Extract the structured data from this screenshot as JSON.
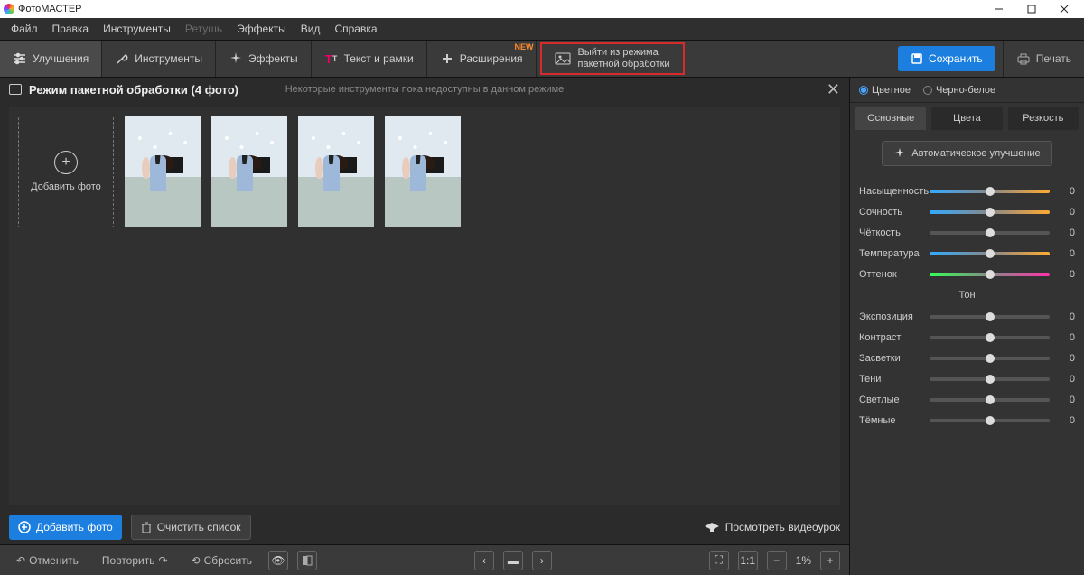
{
  "titlebar": {
    "title": "ФотоМАСТЕР"
  },
  "menu": {
    "items": [
      "Файл",
      "Правка",
      "Инструменты",
      "Ретушь",
      "Эффекты",
      "Вид",
      "Справка"
    ],
    "disabled_index": 3
  },
  "toolbar": {
    "improve": "Улучшения",
    "tools": "Инструменты",
    "effects": "Эффекты",
    "text": "Текст и рамки",
    "ext": "Расширения",
    "ext_new": "NEW",
    "exit_l1": "Выйти из режима",
    "exit_l2": "пакетной обработки",
    "save": "Сохранить",
    "print": "Печать"
  },
  "batch": {
    "title": "Режим пакетной обработки (4 фото)",
    "note": "Некоторые инструменты пока недоступны в данном режиме",
    "add": "Добавить фото",
    "add2": "Добавить фото",
    "clear": "Очистить список",
    "video": "Посмотреть видеоурок"
  },
  "status": {
    "undo": "Отменить",
    "redo": "Повторить",
    "reset": "Сбросить",
    "ratio": "1:1",
    "zoom": "1%"
  },
  "right": {
    "color": "Цветное",
    "bw": "Черно-белое",
    "tab_basic": "Основные",
    "tab_color": "Цвета",
    "tab_sharp": "Резкость",
    "auto": "Автоматическое улучшение",
    "group_tone": "Тон",
    "sliders1": [
      {
        "label": "Насыщенность",
        "kind": "hue",
        "val": "0"
      },
      {
        "label": "Сочность",
        "kind": "hue",
        "val": "0"
      },
      {
        "label": "Чёткость",
        "kind": "",
        "val": "0"
      },
      {
        "label": "Температура",
        "kind": "temp",
        "val": "0"
      },
      {
        "label": "Оттенок",
        "kind": "tint",
        "val": "0"
      }
    ],
    "sliders2": [
      {
        "label": "Экспозиция",
        "val": "0"
      },
      {
        "label": "Контраст",
        "val": "0"
      },
      {
        "label": "Засветки",
        "val": "0"
      },
      {
        "label": "Тени",
        "val": "0"
      },
      {
        "label": "Светлые",
        "val": "0"
      },
      {
        "label": "Тёмные",
        "val": "0"
      }
    ]
  }
}
